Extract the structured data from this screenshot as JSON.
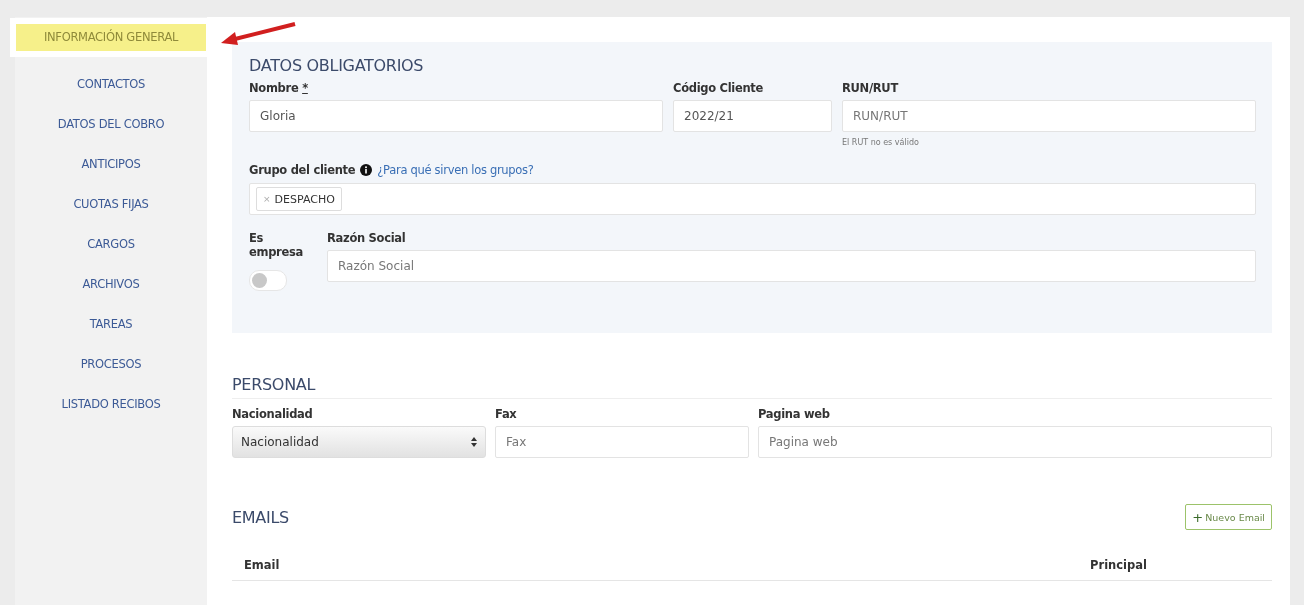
{
  "sidebar": {
    "items": [
      {
        "label": "INFORMACIÓN GENERAL",
        "selected": true
      },
      {
        "label": "CONTACTOS",
        "selected": false
      },
      {
        "label": "DATOS DEL COBRO",
        "selected": false
      },
      {
        "label": "ANTICIPOS",
        "selected": false
      },
      {
        "label": "CUOTAS FIJAS",
        "selected": false
      },
      {
        "label": "CARGOS",
        "selected": false
      },
      {
        "label": "ARCHIVOS",
        "selected": false
      },
      {
        "label": "TAREAS",
        "selected": false
      },
      {
        "label": "PROCESOS",
        "selected": false
      },
      {
        "label": "LISTADO RECIBOS",
        "selected": false
      }
    ]
  },
  "datos_obligatorios": {
    "title": "DATOS OBLIGATORIOS",
    "nombre": {
      "label": "Nombre",
      "required_mark": "*",
      "value": "Gloria"
    },
    "codigo_cliente": {
      "label": "Código Cliente",
      "value": "2022/21"
    },
    "run_rut": {
      "label": "RUN/RUT",
      "placeholder": "RUN/RUT",
      "error": "El RUT no es válido"
    },
    "grupo": {
      "label": "Grupo del cliente",
      "help_link": "¿Para qué sirven los grupos?",
      "tags": [
        {
          "remove": "×",
          "label": "DESPACHO"
        }
      ]
    },
    "es_empresa": {
      "label": "Es empresa",
      "on": false
    },
    "razon_social": {
      "label": "Razón Social",
      "placeholder": "Razón Social"
    }
  },
  "personal": {
    "title": "PERSONAL",
    "fields": [
      {
        "kind": "select",
        "label": "Nacionalidad",
        "value": "Nacionalidad"
      },
      {
        "kind": "input",
        "label": "Fax",
        "placeholder": "Fax"
      },
      {
        "kind": "input",
        "label": "Pagina web",
        "placeholder": "Pagina web"
      }
    ]
  },
  "emails": {
    "title": "EMAILS",
    "button": {
      "icon": "+",
      "label": "Nuevo Email"
    },
    "columns": [
      "Email",
      "Principal"
    ]
  }
}
